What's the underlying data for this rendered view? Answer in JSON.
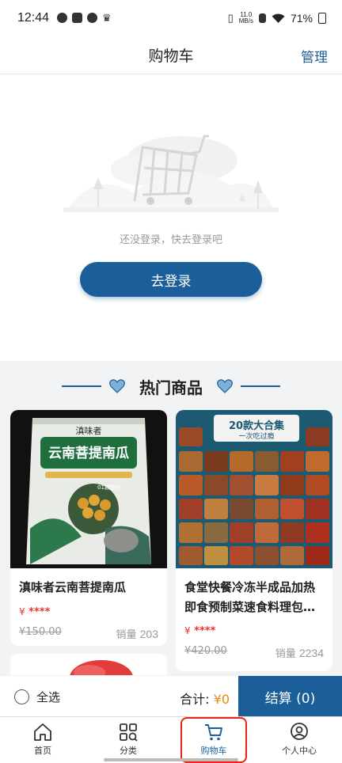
{
  "status_bar": {
    "time": "12:44",
    "network_speed_top": "11.0",
    "network_speed_bottom": "MB/s",
    "battery": "71%"
  },
  "nav": {
    "title": "购物车",
    "manage": "管理"
  },
  "empty_cart": {
    "message": "还没登录，快去登录吧",
    "login_button": "去登录"
  },
  "hot": {
    "title": "热门商品"
  },
  "products": [
    {
      "name": "滇味者云南菩提南瓜",
      "currency": "¥",
      "price_masked": "****",
      "old_price": "¥150.00",
      "sales_label": "销量",
      "sales": "203",
      "image_text": {
        "brand": "滇味者",
        "title": "云南菩提南瓜",
        "tag": "01款脆皮"
      }
    },
    {
      "name": "食堂快餐冷冻半成品加热即食预制菜速食料理包…",
      "currency": "¥",
      "price_masked": "****",
      "old_price": "¥420.00",
      "sales_label": "销量",
      "sales": "2234",
      "image_text": {
        "title": "20款大合集",
        "subtitle": "一次吃过瘾"
      }
    }
  ],
  "checkout": {
    "select_all": "全选",
    "total_label": "合计:",
    "total_value": "¥0",
    "button": "结算 (0)"
  },
  "tabs": [
    {
      "label": "首页",
      "icon": "home-icon"
    },
    {
      "label": "分类",
      "icon": "category-grid-icon"
    },
    {
      "label": "购物车",
      "icon": "cart-icon",
      "active": true
    },
    {
      "label": "个人中心",
      "icon": "user-icon"
    }
  ],
  "colors": {
    "primary": "#1a5f99",
    "price_red": "#e33",
    "total_orange": "#e8880f",
    "highlight_red": "#e21"
  }
}
